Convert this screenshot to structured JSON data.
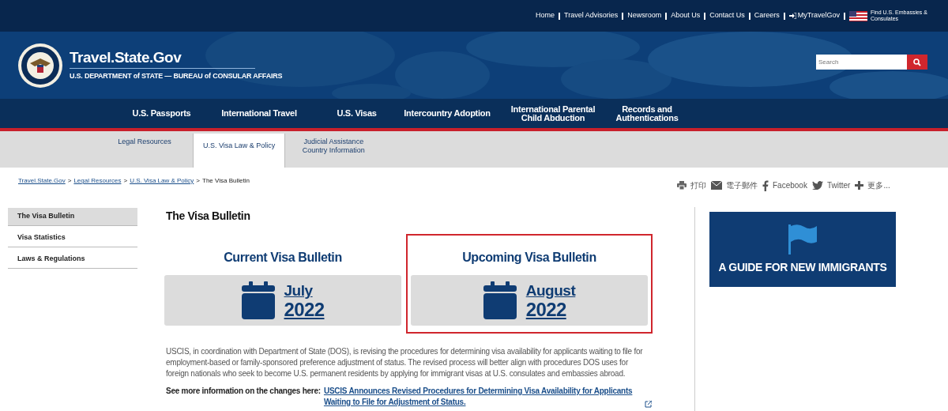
{
  "top_links": [
    {
      "label": "Home",
      "kind": "text"
    },
    {
      "label": "Travel Advisories",
      "kind": "text"
    },
    {
      "label": "Newsroom",
      "kind": "text"
    },
    {
      "label": "About Us",
      "kind": "text"
    },
    {
      "label": "Contact Us",
      "kind": "text"
    },
    {
      "label": "Careers",
      "kind": "text"
    },
    {
      "label": "MyTravelGov",
      "kind": "login"
    }
  ],
  "embassy_link": "Find U.S. Embassies & Consulates",
  "site": {
    "title": "Travel.State.Gov",
    "subtitle": "U.S. DEPARTMENT of STATE — BUREAU of CONSULAR AFFAIRS"
  },
  "search": {
    "placeholder": "Search"
  },
  "nav": [
    "U.S. Passports",
    "International Travel",
    "U.S. Visas",
    "Intercountry Adoption",
    "International Parental Child Abduction",
    "Records and Authentications"
  ],
  "subnav": [
    {
      "label": "Legal Resources",
      "selected": false
    },
    {
      "label": "U.S. Visa Law & Policy",
      "selected": true
    },
    {
      "label": "Judicial Assistance Country Information",
      "selected": false
    }
  ],
  "breadcrumb": {
    "links": [
      "Travel.State.Gov",
      "Legal Resources",
      "U.S. Visa Law & Policy"
    ],
    "separator": ">",
    "current": "The Visa Bulletin"
  },
  "share": [
    {
      "kind": "print",
      "label": "打印"
    },
    {
      "kind": "email",
      "label": "電子郵件"
    },
    {
      "kind": "facebook",
      "label": "Facebook"
    },
    {
      "kind": "twitter",
      "label": "Twitter"
    },
    {
      "kind": "more",
      "label": "更多..."
    }
  ],
  "sidebar": [
    {
      "label": "The Visa Bulletin",
      "selected": true
    },
    {
      "label": "Visa Statistics",
      "selected": false
    },
    {
      "label": "Laws & Regulations",
      "selected": false
    }
  ],
  "page_title": "The Visa Bulletin",
  "bulletins": [
    {
      "heading": "Current Visa Bulletin",
      "month": "July",
      "year": "2022",
      "highlighted": false
    },
    {
      "heading": "Upcoming Visa Bulletin",
      "month": "August",
      "year": "2022",
      "highlighted": true
    }
  ],
  "paragraph": "USCIS, in coordination with Department of State (DOS), is revising the procedures for determining visa availability for applicants waiting to file for employment-based or family-sponsored preference adjustment of status. The revised process will better align with procedures DOS uses for foreign nationals who seek to become U.S. permanent residents by applying for immigrant visas at U.S. consulates and embassies abroad.",
  "more_info": {
    "label": "See more information on the changes here:",
    "link": "USCIS Announces Revised Procedures for Determining Visa Availability for Applicants Waiting to File for Adjustment of Status."
  },
  "guide": {
    "label": "A GUIDE FOR NEW IMMIGRANTS"
  }
}
